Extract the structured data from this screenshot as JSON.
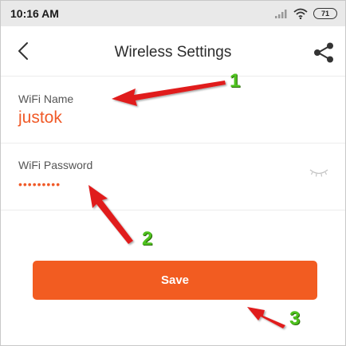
{
  "status_bar": {
    "time": "10:16 AM",
    "battery": "71",
    "icons": [
      "signal-icon",
      "wifi-icon",
      "battery-icon"
    ]
  },
  "header": {
    "title": "Wireless Settings",
    "back_icon": "chevron-left-icon",
    "share_icon": "share-icon"
  },
  "wifi_name": {
    "label": "WiFi Name",
    "value": "justok"
  },
  "wifi_password": {
    "label": "WiFi Password",
    "masked_value": "•••••••••",
    "toggle_icon": "eye-closed-icon"
  },
  "save_button": {
    "label": "Save"
  },
  "annotations": {
    "callout_1": "1",
    "callout_2": "2",
    "callout_3": "3"
  },
  "colors": {
    "accent": "#f25c21",
    "value_text": "#f05a28",
    "arrow": "#e01b1b",
    "callout": "#4fc21f",
    "status_bar_bg": "#e9e9e9"
  }
}
